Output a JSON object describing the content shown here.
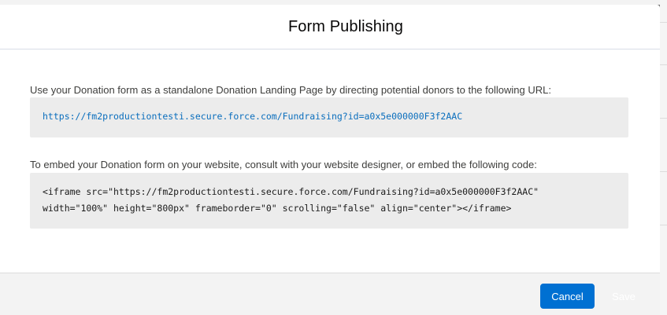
{
  "modal": {
    "title": "Form Publishing",
    "url_description": "Use your Donation form as a standalone Donation Landing Page by directing potential donors to the following URL:",
    "url": "https://fm2productiontesti.secure.force.com/Fundraising?id=a0x5e000000F3f2AAC",
    "embed_description": "To embed your Donation form on your website, consult with your website designer, or embed the following code:",
    "embed_code_line1": "<iframe src=\"https://fm2productiontesti.secure.force.com/Fundraising?id=a0x5e000000F3f2AAC\"",
    "embed_code_line2": "width=\"100%\" height=\"800px\" frameborder=\"0\" scrolling=\"false\" align=\"center\"></iframe>"
  },
  "footer": {
    "cancel_label": "Cancel",
    "save_label": "Save"
  },
  "colors": {
    "primary_button": "#0070d2",
    "link": "#0a6ebd",
    "code_background": "#ececec",
    "footer_background": "#f3f3f3"
  }
}
